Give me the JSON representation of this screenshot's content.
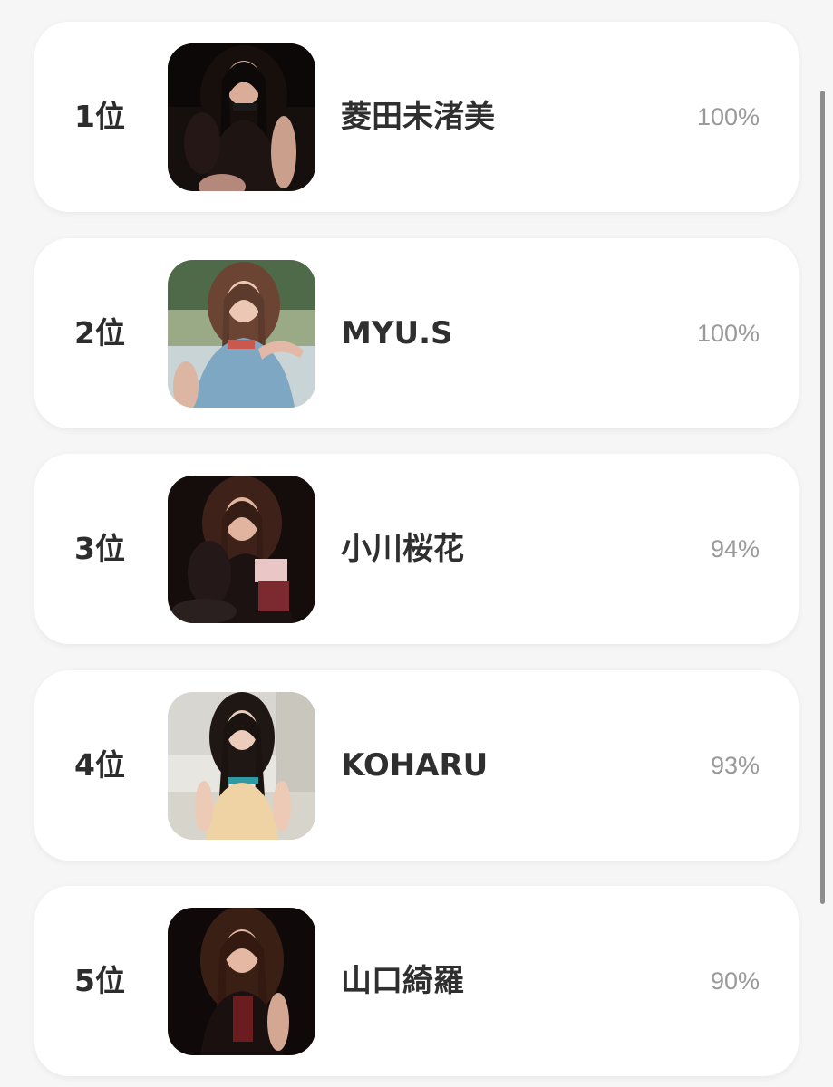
{
  "ranking": {
    "items": [
      {
        "rank": "1位",
        "name": "菱田未渚美",
        "percent": "100%",
        "photo": "photo-1"
      },
      {
        "rank": "2位",
        "name": "MYU.S",
        "percent": "100%",
        "photo": "photo-2"
      },
      {
        "rank": "3位",
        "name": "小川桜花",
        "percent": "94%",
        "photo": "photo-3"
      },
      {
        "rank": "4位",
        "name": "KOHARU",
        "percent": "93%",
        "photo": "photo-4"
      },
      {
        "rank": "5位",
        "name": "山口綺羅",
        "percent": "90%",
        "photo": "photo-5"
      }
    ]
  },
  "colors": {
    "page_background": "#f6f6f6",
    "card_background": "#ffffff",
    "rank_text": "#2d2d2d",
    "name_text": "#2f2f2f",
    "percent_text": "#9a9a9a"
  }
}
